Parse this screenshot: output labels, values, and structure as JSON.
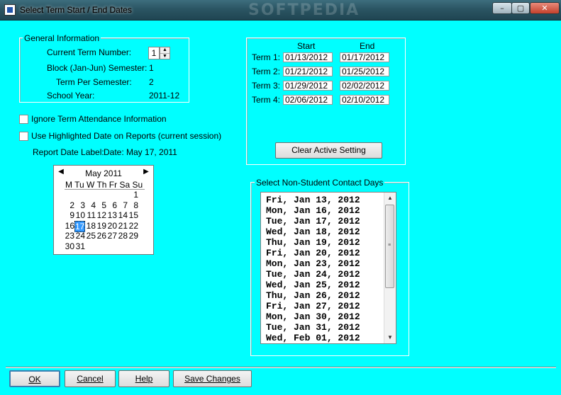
{
  "window": {
    "title": "Select Term Start / End Dates",
    "watermark": "SOFTPEDIA",
    "minimize_glyph": "–",
    "maximize_glyph": "▢",
    "close_glyph": "✕"
  },
  "general_info": {
    "group_label": "General Information",
    "current_term_label": "Current Term Number:",
    "current_term_value": "1",
    "block_label": "Block (Jan-Jun)  Semester:",
    "block_value": "1",
    "term_per_sem_label": "Term Per Semester:",
    "term_per_sem_value": "2",
    "school_year_label": "School Year:",
    "school_year_value": "2011-12"
  },
  "options": {
    "ignore_attendance_label": "Ignore Term Attendance Information",
    "ignore_attendance_checked": false,
    "use_highlighted_label": "Use Highlighted Date on Reports (current session)",
    "use_highlighted_checked": false,
    "report_date_label": "Report Date Label:",
    "report_date_value": "Date: May 17, 2011"
  },
  "calendar": {
    "month_label": "May 2011",
    "prev_glyph": "◀",
    "next_glyph": "▶",
    "dow_header": "M Tu W Th  Fr Sa Su",
    "weeks": [
      [
        "",
        "",
        "",
        "",
        "",
        "",
        "1"
      ],
      [
        "2",
        "3",
        "4",
        "5",
        "6",
        "7",
        "8"
      ],
      [
        "9",
        "10",
        "11",
        "12",
        "13",
        "14",
        "15"
      ],
      [
        "16",
        "17",
        "18",
        "19",
        "20",
        "21",
        "22"
      ],
      [
        "23",
        "24",
        "25",
        "26",
        "27",
        "28",
        "29"
      ],
      [
        "30",
        "31",
        "",
        "",
        "",
        "",
        ""
      ]
    ],
    "selected_day": "17"
  },
  "terms": {
    "start_header": "Start",
    "end_header": "End",
    "rows": [
      {
        "label": "Term 1:",
        "start": "01/13/2012",
        "end": "01/17/2012"
      },
      {
        "label": "Term 2:",
        "start": "01/21/2012",
        "end": "01/25/2012"
      },
      {
        "label": "Term 3:",
        "start": "01/29/2012",
        "end": "02/02/2012"
      },
      {
        "label": "Term 4:",
        "start": "02/06/2012",
        "end": "02/10/2012"
      }
    ],
    "clear_button_label": "Clear Active Setting"
  },
  "contact_days": {
    "group_label": "Select Non-Student Contact Days",
    "items": [
      "Fri, Jan 13, 2012",
      "Mon, Jan 16, 2012",
      "Tue, Jan 17, 2012",
      "Wed, Jan 18, 2012",
      "Thu, Jan 19, 2012",
      "Fri, Jan 20, 2012",
      "Mon, Jan 23, 2012",
      "Tue, Jan 24, 2012",
      "Wed, Jan 25, 2012",
      "Thu, Jan 26, 2012",
      "Fri, Jan 27, 2012",
      "Mon, Jan 30, 2012",
      "Tue, Jan 31, 2012",
      "Wed, Feb 01, 2012"
    ],
    "scroll_up_glyph": "▲",
    "scroll_down_glyph": "▼"
  },
  "buttons": {
    "ok": "OK",
    "cancel": "Cancel",
    "help": "Help",
    "save": "Save Changes"
  }
}
